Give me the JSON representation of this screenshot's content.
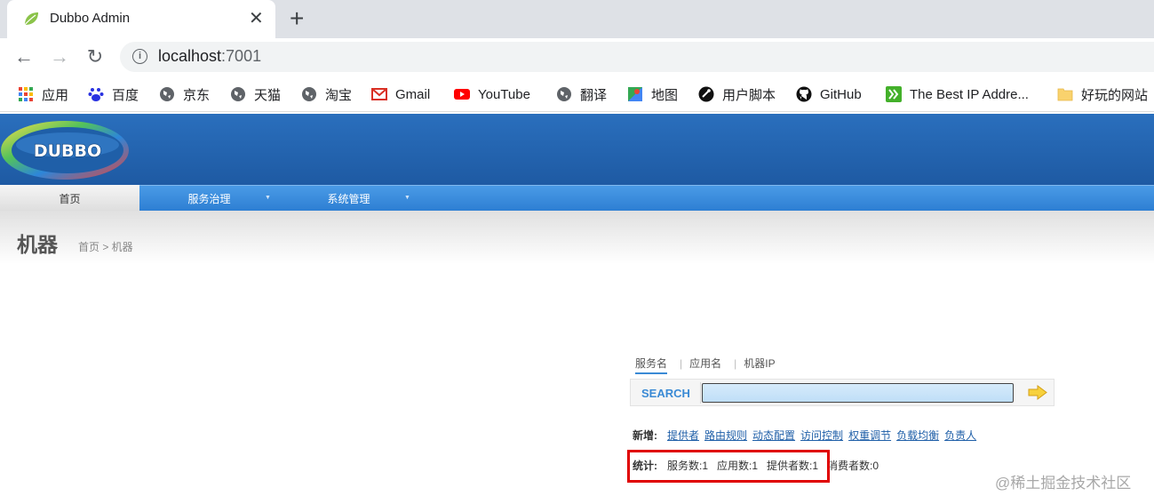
{
  "browser": {
    "tab_title": "Dubbo Admin",
    "tab_close": "✕",
    "new_tab": "+",
    "url_host": "localhost",
    "url_port": ":7001",
    "bookmarks": [
      {
        "label": "应用",
        "icon": "apps-grid-icon"
      },
      {
        "label": "百度",
        "icon": "baidu-paw-icon"
      },
      {
        "label": "京东",
        "icon": "globe-icon"
      },
      {
        "label": "天猫",
        "icon": "globe-icon"
      },
      {
        "label": "淘宝",
        "icon": "globe-icon"
      },
      {
        "label": "Gmail",
        "icon": "gmail-icon"
      },
      {
        "label": "YouTube",
        "icon": "youtube-icon"
      },
      {
        "label": "翻译",
        "icon": "globe-icon"
      },
      {
        "label": "地图",
        "icon": "maps-icon"
      },
      {
        "label": "用户脚本",
        "icon": "userscript-icon"
      },
      {
        "label": "GitHub",
        "icon": "github-icon"
      },
      {
        "label": "The Best IP Addre...",
        "icon": "ip-arrow-icon"
      },
      {
        "label": "好玩的网站",
        "icon": "folder-icon"
      }
    ]
  },
  "app": {
    "logo_text": "DUBBO",
    "nav": [
      {
        "label": "首页"
      },
      {
        "label": "服务治理"
      },
      {
        "label": "系统管理"
      }
    ],
    "page_title": "机器",
    "breadcrumb": "首页 > 机器"
  },
  "search": {
    "tabs": [
      "服务名",
      "应用名",
      "机器IP"
    ],
    "label": "SEARCH",
    "value": ""
  },
  "add": {
    "label": "新增:",
    "links": [
      "提供者",
      "路由规则",
      "动态配置",
      "访问控制",
      "权重调节",
      "负载均衡",
      "负责人"
    ]
  },
  "stats": {
    "label": "统计:",
    "items": [
      "服务数:1",
      "应用数:1",
      "提供者数:1",
      "消费者数:0"
    ]
  },
  "watermark": "@稀土掘金技术社区",
  "colors": {
    "header_blue": "#2a6fbd",
    "nav_blue": "#3a8ad5",
    "highlight_red": "#e00000"
  }
}
